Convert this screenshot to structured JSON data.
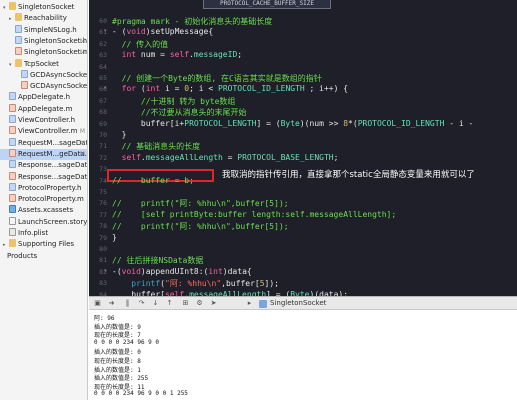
{
  "sidebar": {
    "items": [
      {
        "label": "SingletonSocket",
        "indent": 0,
        "icon": "folder",
        "tri": "▾",
        "badge": ""
      },
      {
        "label": "Reachability",
        "indent": 1,
        "icon": "folder",
        "tri": "▸",
        "badge": ""
      },
      {
        "label": "SimpleNSLog.h",
        "indent": 1,
        "icon": "h",
        "tri": "",
        "badge": ""
      },
      {
        "label": "SingletonSocket.h",
        "indent": 1,
        "icon": "h",
        "tri": "",
        "badge": "M"
      },
      {
        "label": "SingletonSocket.m",
        "indent": 1,
        "icon": "m",
        "tri": "",
        "badge": "M"
      },
      {
        "label": "TcpSocket",
        "indent": 1,
        "icon": "folder",
        "tri": "▾",
        "badge": ""
      },
      {
        "label": "GCDAsyncSocket.h",
        "indent": 2,
        "icon": "h",
        "tri": "",
        "badge": ""
      },
      {
        "label": "GCDAsyncSocket.m",
        "indent": 2,
        "icon": "m",
        "tri": "",
        "badge": ""
      },
      {
        "label": "AppDelegate.h",
        "indent": 0,
        "icon": "h",
        "tri": "",
        "badge": ""
      },
      {
        "label": "AppDelegate.m",
        "indent": 0,
        "icon": "m",
        "tri": "",
        "badge": ""
      },
      {
        "label": "ViewController.h",
        "indent": 0,
        "icon": "h",
        "tri": "",
        "badge": ""
      },
      {
        "label": "ViewController.m",
        "indent": 0,
        "icon": "m",
        "tri": "",
        "badge": "M"
      },
      {
        "label": "RequestM...sageData.h",
        "indent": 0,
        "icon": "h",
        "tri": "",
        "badge": "M"
      },
      {
        "label": "RequestM...geData.m",
        "indent": 0,
        "icon": "m",
        "tri": "",
        "badge": "M",
        "selected": true
      },
      {
        "label": "Response...sageData.h",
        "indent": 0,
        "icon": "h",
        "tri": "",
        "badge": ""
      },
      {
        "label": "Response...sageData.m",
        "indent": 0,
        "icon": "m",
        "tri": "",
        "badge": ""
      },
      {
        "label": "ProtocolProperty.h",
        "indent": 0,
        "icon": "h",
        "tri": "",
        "badge": ""
      },
      {
        "label": "ProtocolProperty.m",
        "indent": 0,
        "icon": "m",
        "tri": "",
        "badge": ""
      },
      {
        "label": "Assets.xcassets",
        "indent": 0,
        "icon": "xc",
        "tri": "",
        "badge": ""
      },
      {
        "label": "LaunchScreen.storyboard",
        "indent": 0,
        "icon": "sb",
        "tri": "",
        "badge": ""
      },
      {
        "label": "Info.plist",
        "indent": 0,
        "icon": "pl",
        "tri": "",
        "badge": ""
      },
      {
        "label": "Supporting Files",
        "indent": 0,
        "icon": "folder",
        "tri": "▸",
        "badge": ""
      },
      {
        "label": "Products",
        "indent": -1,
        "icon": "",
        "tri": "",
        "badge": ""
      }
    ]
  },
  "editor": {
    "top_field": "PROTOCOL_CACHE_BUFFER_SIZE",
    "annotation": "我取消的指针传引用，直接拿那个static全局静态变量来用就可以了",
    "lines": [
      {
        "num": "60",
        "segs": [
          [
            "cm",
            "#pragma mark - 初始化消息头的基础长度"
          ]
        ]
      },
      {
        "num": "61",
        "fold": true,
        "segs": [
          [
            "wh",
            "- ("
          ],
          [
            "kw",
            "void"
          ],
          [
            "wh",
            ")setUpMessage{"
          ]
        ]
      },
      {
        "num": "62",
        "segs": [
          [
            "cm",
            "  // 传入的值"
          ]
        ]
      },
      {
        "num": "63",
        "segs": [
          [
            "kw",
            "  int"
          ],
          [
            "wh",
            " num = "
          ],
          [
            "kw",
            "self"
          ],
          [
            "wh",
            "."
          ],
          [
            "id",
            "messageID"
          ],
          [
            "wh",
            ";"
          ]
        ]
      },
      {
        "num": "64",
        "segs": [
          [
            "wh",
            ""
          ]
        ]
      },
      {
        "num": "65",
        "segs": [
          [
            "cm",
            "  // 创建一个Byte的数组, 在C语言其实就是数组的指针"
          ]
        ]
      },
      {
        "num": "66",
        "fold": true,
        "segs": [
          [
            "kw",
            "  for"
          ],
          [
            "wh",
            " ("
          ],
          [
            "kw",
            "int"
          ],
          [
            "wh",
            " i = "
          ],
          [
            "num",
            "0"
          ],
          [
            "wh",
            "; i < "
          ],
          [
            "id",
            "PROTOCOL_ID_LENGTH"
          ],
          [
            "wh",
            " ; i++) {"
          ]
        ]
      },
      {
        "num": "67",
        "segs": [
          [
            "cm",
            "      //十进制 转为 byte数组"
          ]
        ]
      },
      {
        "num": "68",
        "segs": [
          [
            "cm",
            "      //不过要从消息头的末尾开始"
          ]
        ]
      },
      {
        "num": "69",
        "segs": [
          [
            "wh",
            "      buffer[i+"
          ],
          [
            "id",
            "PROTOCOL_LENGTH"
          ],
          [
            "wh",
            "] = ("
          ],
          [
            "id",
            "Byte"
          ],
          [
            "wh",
            ")(num >> "
          ],
          [
            "num",
            "8"
          ],
          [
            "wh",
            "*("
          ],
          [
            "id",
            "PROTOCOL_ID_LENGTH"
          ],
          [
            "wh",
            " - i -"
          ]
        ]
      },
      {
        "num": "70",
        "segs": [
          [
            "wh",
            "  }"
          ]
        ]
      },
      {
        "num": "71",
        "segs": [
          [
            "cm",
            "  // 基础消息头的长度"
          ]
        ]
      },
      {
        "num": "72",
        "segs": [
          [
            "kw",
            "  self"
          ],
          [
            "wh",
            "."
          ],
          [
            "id",
            "messageAllLength"
          ],
          [
            "wh",
            " = "
          ],
          [
            "id",
            "PROTOCOL_BASE_LENGTH"
          ],
          [
            "wh",
            ";"
          ]
        ]
      },
      {
        "num": "73",
        "segs": [
          [
            "wh",
            ""
          ]
        ]
      },
      {
        "num": "74",
        "segs": [
          [
            "cm",
            "//    buffer = b;"
          ]
        ]
      },
      {
        "num": "75",
        "segs": [
          [
            "wh",
            ""
          ]
        ]
      },
      {
        "num": "76",
        "segs": [
          [
            "cm",
            "//    printf(\"阿: %hhu\\n\",buffer[5]);"
          ]
        ]
      },
      {
        "num": "77",
        "segs": [
          [
            "cm",
            "//    [self printByte:buffer length:self.messageAllLength];"
          ]
        ]
      },
      {
        "num": "78",
        "segs": [
          [
            "cm",
            "//    printf(\"阿: %hhu\\n\",buffer[5]);"
          ]
        ]
      },
      {
        "num": "79",
        "segs": [
          [
            "wh",
            "}"
          ]
        ]
      },
      {
        "num": "80",
        "segs": [
          [
            "wh",
            ""
          ]
        ]
      },
      {
        "num": "81",
        "segs": [
          [
            "cm",
            "// 往后拼接NSData数据"
          ]
        ]
      },
      {
        "num": "82",
        "fold": true,
        "segs": [
          [
            "wh",
            "-("
          ],
          [
            "kw",
            "void"
          ],
          [
            "wh",
            ")appendUInt8:("
          ],
          [
            "kw",
            "int"
          ],
          [
            "wh",
            ")data{"
          ]
        ]
      },
      {
        "num": "83",
        "segs": [
          [
            "fn",
            "    printf"
          ],
          [
            "wh",
            "("
          ],
          [
            "str",
            "\"阿: %hhu\\n\""
          ],
          [
            "wh",
            ",buffer["
          ],
          [
            "num",
            "5"
          ],
          [
            "wh",
            "]);"
          ]
        ]
      },
      {
        "num": "84",
        "segs": [
          [
            "wh",
            "    buffer["
          ],
          [
            "kw",
            "self"
          ],
          [
            "wh",
            "."
          ],
          [
            "id",
            "messageAllLength"
          ],
          [
            "wh",
            "] = ("
          ],
          [
            "id",
            "Byte"
          ],
          [
            "wh",
            ")(data);"
          ]
        ]
      },
      {
        "num": "85",
        "segs": [
          [
            "wh",
            "    ["
          ],
          [
            "kw",
            "self"
          ],
          [
            "wh",
            " printByte:buffer length:"
          ],
          [
            "kw",
            "self"
          ],
          [
            "wh",
            "."
          ],
          [
            "id",
            "messageAllLength"
          ],
          [
            "wh",
            "];"
          ]
        ]
      }
    ]
  },
  "debug_bar": {
    "crumb": "SingletonSocket"
  },
  "console": {
    "lines": [
      "阿: 96",
      "插入的数值是: 9",
      "现在的长度是: 7",
      "0 0 0 0 234 96 9 0",
      "插入的数值是: 0",
      "现在的长度是: 8",
      "插入的数值是: 1",
      "插入的数值是: 255",
      "现在的长度是: 11",
      "0 0 0 0 234 96 9 0 0 1 255"
    ]
  }
}
